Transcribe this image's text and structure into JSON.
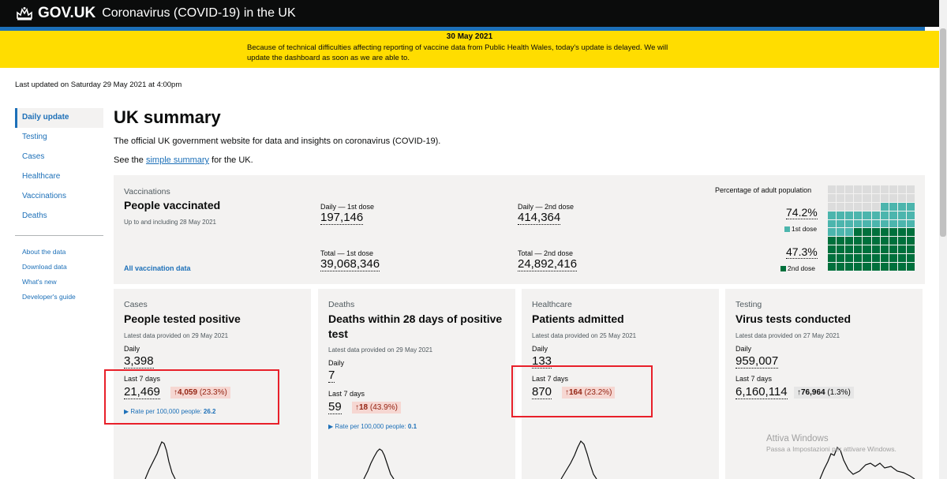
{
  "header": {
    "logo": "GOV.UK",
    "title": "Coronavirus (COVID-19) in the UK"
  },
  "banner": {
    "date": "30 May 2021",
    "message": "Because of technical difficulties affecting reporting of vaccine data from Public Health Wales, today's update is delayed. We will update the dashboard as soon as we are able to."
  },
  "last_updated": "Last updated on Saturday 29 May 2021 at 4:00pm",
  "sidenav": {
    "items": [
      {
        "label": "Daily update"
      },
      {
        "label": "Testing"
      },
      {
        "label": "Cases"
      },
      {
        "label": "Healthcare"
      },
      {
        "label": "Vaccinations"
      },
      {
        "label": "Deaths"
      }
    ],
    "secondary": [
      {
        "label": "About the data"
      },
      {
        "label": "Download data"
      },
      {
        "label": "What's new"
      },
      {
        "label": "Developer's guide"
      }
    ]
  },
  "main": {
    "title": "UK summary",
    "intro": "The official UK government website for data and insights on coronavirus (COVID-19).",
    "see_prefix": "See the ",
    "see_link": "simple summary",
    "see_suffix": " for the UK."
  },
  "vaccinations": {
    "category": "Vaccinations",
    "title": "People vaccinated",
    "subtitle": "Up to and including 28 May 2021",
    "link": "All vaccination data",
    "daily_1st_label": "Daily — 1st dose",
    "daily_1st_value": "197,146",
    "daily_2nd_label": "Daily — 2nd dose",
    "daily_2nd_value": "414,364",
    "total_1st_label": "Total — 1st dose",
    "total_1st_value": "39,068,346",
    "total_2nd_label": "Total — 2nd dose",
    "total_2nd_value": "24,892,416",
    "pct_label": "Percentage of adult population",
    "pct_1st": "74.2%",
    "pct_1st_legend": "1st dose",
    "pct_2nd": "47.3%",
    "pct_2nd_legend": "2nd dose",
    "pct_1st_fraction": 0.742,
    "pct_2nd_fraction": 0.473,
    "color_1st": "#4cb5ad",
    "color_2nd": "#00703c"
  },
  "cards": [
    {
      "category": "Cases",
      "title": "People tested positive",
      "subtitle": "Latest data provided on 29 May 2021",
      "daily_label": "Daily",
      "daily_value": "3,398",
      "l7_label": "Last 7 days",
      "l7_value": "21,469",
      "change": "4,059",
      "change_pct": "(23.3%)",
      "rate_label": "Rate per 100,000 people:",
      "rate_value": "26.2"
    },
    {
      "category": "Deaths",
      "title": "Deaths within 28 days of positive test",
      "subtitle": "Latest data provided on 29 May 2021",
      "daily_label": "Daily",
      "daily_value": "7",
      "l7_label": "Last 7 days",
      "l7_value": "59",
      "change": "18",
      "change_pct": "(43.9%)",
      "rate_label": "Rate per 100,000 people:",
      "rate_value": "0.1"
    },
    {
      "category": "Healthcare",
      "title": "Patients admitted",
      "subtitle": "Latest data provided on 25 May 2021",
      "daily_label": "Daily",
      "daily_value": "133",
      "l7_label": "Last 7 days",
      "l7_value": "870",
      "change": "164",
      "change_pct": "(23.2%)"
    },
    {
      "category": "Testing",
      "title": "Virus tests conducted",
      "subtitle": "Latest data provided on 27 May 2021",
      "daily_label": "Daily",
      "daily_value": "959,007",
      "l7_label": "Last 7 days",
      "l7_value": "6,160,114",
      "change": "76,964",
      "change_pct": "(1.3%)"
    }
  ],
  "watermark": {
    "line1": "Attiva Windows",
    "line2": "Passa a Impostazioni per attivare Windows."
  }
}
